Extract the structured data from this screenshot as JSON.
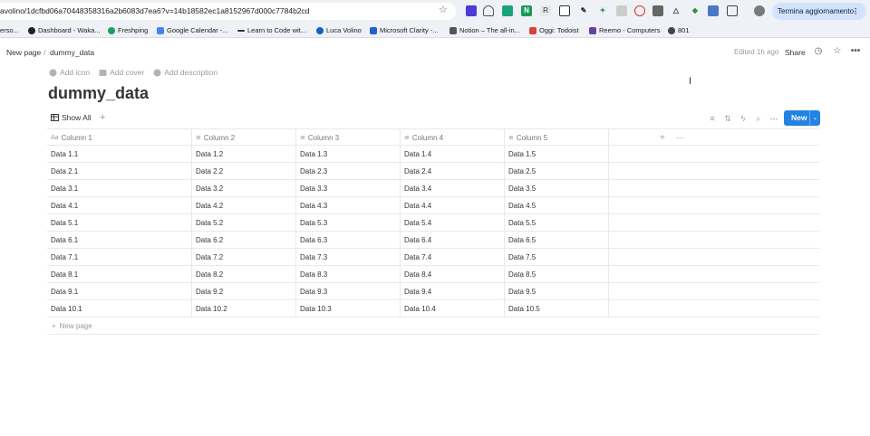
{
  "browser": {
    "url": "avolino/1dcfbd06a70448358316a2b6083d7ea6?v=14b18582ec1a8152967d000c7784b2cd",
    "update_button": "Termina aggiornamento",
    "icons": [
      "star-icon",
      "extension-icons",
      "profile-avatar"
    ]
  },
  "bookmarks": [
    {
      "label": "erso...",
      "color": "#888888"
    },
    {
      "label": "Dashboard - Waka...",
      "color": "#222222"
    },
    {
      "label": "Freshping",
      "color": "#1aa260"
    },
    {
      "label": "Google Calendar -...",
      "color": "#4285f4"
    },
    {
      "label": "Learn to Code wit...",
      "color": "#333333"
    },
    {
      "label": "Luca Volino",
      "color": "#0a66c2"
    },
    {
      "label": "Microsoft Clarity -...",
      "color": "#1e62d0"
    },
    {
      "label": "Notion – The all-in...",
      "color": "#555555"
    },
    {
      "label": "Oggi: Todoist",
      "color": "#db4035"
    },
    {
      "label": "Reemo - Computers",
      "color": "#6a3fa0"
    },
    {
      "label": "801",
      "color": "#444444"
    }
  ],
  "topbar": {
    "breadcrumb": [
      "New page",
      "dummy_data"
    ],
    "edited": "Edited 1h ago",
    "share": "Share"
  },
  "page": {
    "actions": [
      "Add icon",
      "Add cover",
      "Add description"
    ],
    "title": "dummy_data"
  },
  "view": {
    "tab": "Show All",
    "new_button": "New"
  },
  "table": {
    "columns": [
      "Column 1",
      "Column 2",
      "Column 3",
      "Column 4",
      "Column 5"
    ],
    "rows": [
      [
        "Data 1.1",
        "Data 1.2",
        "Data 1.3",
        "Data 1.4",
        "Data 1.5"
      ],
      [
        "Data 2.1",
        "Data 2.2",
        "Data 2.3",
        "Data 2.4",
        "Data 2.5"
      ],
      [
        "Data 3.1",
        "Data 3.2",
        "Data 3.3",
        "Data 3.4",
        "Data 3.5"
      ],
      [
        "Data 4.1",
        "Data 4.2",
        "Data 4.3",
        "Data 4.4",
        "Data 4.5"
      ],
      [
        "Data 5.1",
        "Data 5.2",
        "Data 5.3",
        "Data 5.4",
        "Data 5.5"
      ],
      [
        "Data 6.1",
        "Data 6.2",
        "Data 6.3",
        "Data 6.4",
        "Data 6.5"
      ],
      [
        "Data 7.1",
        "Data 7.2",
        "Data 7.3",
        "Data 7.4",
        "Data 7.5"
      ],
      [
        "Data 8.1",
        "Data 8.2",
        "Data 8.3",
        "Data 8.4",
        "Data 8.5"
      ],
      [
        "Data 9.1",
        "Data 9.2",
        "Data 9.3",
        "Data 9.4",
        "Data 9.5"
      ],
      [
        "Data 10.1",
        "Data 10.2",
        "Data 10.3",
        "Data 10.4",
        "Data 10.5"
      ]
    ],
    "new_page": "New page"
  }
}
